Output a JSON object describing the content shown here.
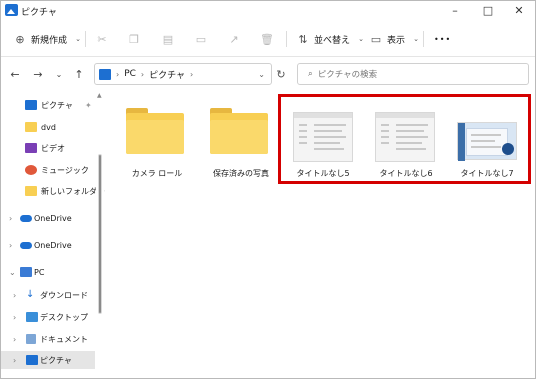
{
  "window": {
    "title": "ピクチャ",
    "controls": {
      "minimize": "–",
      "maximize": "□",
      "close": "✕"
    }
  },
  "toolbar": {
    "new_label": "新規作成",
    "sort_label": "並べ替え",
    "view_label": "表示",
    "more_label": "•••"
  },
  "address": {
    "segments": [
      "PC",
      "ピクチャ"
    ],
    "search_placeholder": "ピクチャの検索"
  },
  "sidebar": {
    "items": [
      {
        "label": "ピクチャ",
        "icon": "pictures-icon"
      },
      {
        "label": "dvd",
        "icon": "folder-icon"
      },
      {
        "label": "ビデオ",
        "icon": "videos-icon"
      },
      {
        "label": "ミュージック",
        "icon": "music-icon"
      },
      {
        "label": "新しいフォルダー",
        "icon": "folder-icon"
      },
      {
        "label": "OneDrive",
        "icon": "onedrive-icon"
      },
      {
        "label": "OneDrive",
        "icon": "onedrive-icon"
      },
      {
        "label": "PC",
        "icon": "pc-icon"
      },
      {
        "label": "ダウンロード",
        "icon": "download-icon"
      },
      {
        "label": "デスクトップ",
        "icon": "desktop-icon"
      },
      {
        "label": "ドキュメント",
        "icon": "documents-icon"
      },
      {
        "label": "ピクチャ",
        "icon": "pictures-icon"
      }
    ]
  },
  "files": [
    {
      "name": "カメラ ロール",
      "type": "folder"
    },
    {
      "name": "保存済みの写真",
      "type": "folder"
    },
    {
      "name": "タイトルなし5",
      "type": "image"
    },
    {
      "name": "タイトルなし6",
      "type": "image"
    },
    {
      "name": "タイトルなし7",
      "type": "image"
    }
  ],
  "colors": {
    "accent": "#1d6fd1",
    "highlight_box": "#d40000",
    "folder": "#f8cf53"
  }
}
